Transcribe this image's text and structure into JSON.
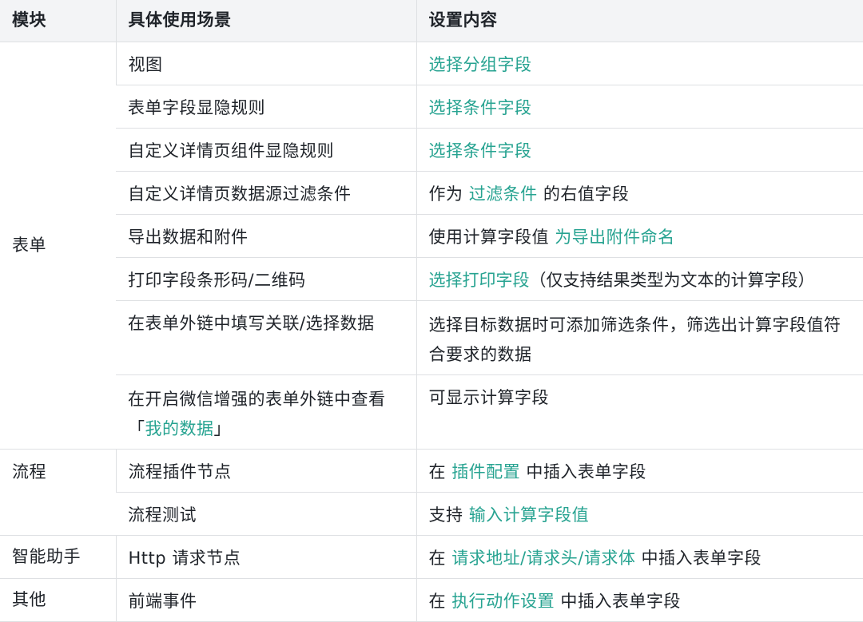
{
  "headers": [
    "模块",
    "具体使用场景",
    "设置内容"
  ],
  "colors": {
    "link": "#27a391",
    "header_bg": "#f3f4f6",
    "border": "#dee0e3"
  },
  "rows": {
    "r1": {
      "module": "表单",
      "scene": "视图",
      "setting": {
        "link": "选择分组字段"
      }
    },
    "r2": {
      "scene": "表单字段显隐规则",
      "setting": {
        "link": "选择条件字段"
      }
    },
    "r3": {
      "scene": "自定义详情页组件显隐规则",
      "setting": {
        "link": "选择条件字段"
      }
    },
    "r4": {
      "scene": "自定义详情页数据源过滤条件",
      "setting": {
        "pre": "作为 ",
        "link": "过滤条件",
        "post": " 的右值字段"
      }
    },
    "r5": {
      "scene": "导出数据和附件",
      "setting": {
        "pre": "使用计算字段值 ",
        "link": "为导出附件命名"
      }
    },
    "r6": {
      "scene": "打印字段条形码/二维码",
      "setting": {
        "link": "选择打印字段",
        "post": "（仅支持结果类型为文本的计算字段）"
      }
    },
    "r7": {
      "scene": "在表单外链中填写关联/选择数据",
      "setting": {
        "text": "选择目标数据时可添加筛选条件，筛选出计算字段值符合要求的数据"
      }
    },
    "r8": {
      "scene_pre": "在开启微信增强的表单外链中查看「",
      "scene_link": "我的数据",
      "scene_post": "」",
      "setting": {
        "text": "可显示计算字段"
      }
    },
    "r9": {
      "module": "流程",
      "scene": "流程插件节点",
      "setting": {
        "pre": "在 ",
        "link": "插件配置",
        "post": " 中插入表单字段"
      }
    },
    "r10": {
      "scene": "流程测试",
      "setting": {
        "pre": "支持 ",
        "link": "输入计算字段值"
      }
    },
    "r11": {
      "module": "智能助手",
      "scene": "Http 请求节点",
      "setting": {
        "pre": "在 ",
        "link": "请求地址/请求头/请求体",
        "post": " 中插入表单字段"
      }
    },
    "r12": {
      "module": "其他",
      "scene": "前端事件",
      "setting": {
        "pre": "在 ",
        "link": "执行动作设置",
        "post": " 中插入表单字段"
      }
    }
  }
}
